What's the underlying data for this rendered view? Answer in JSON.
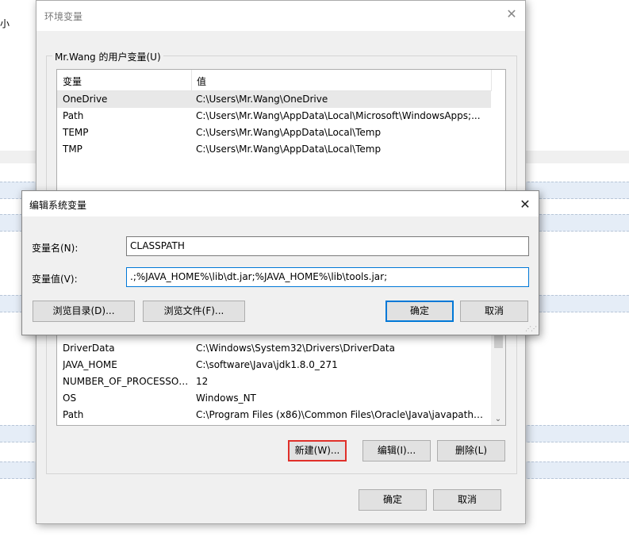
{
  "background": {
    "partial_text": "大小"
  },
  "env_dialog": {
    "title": "环境变量",
    "user_group_label": "Mr.Wang 的用户变量(U)",
    "columns": {
      "name": "变量",
      "value": "值"
    },
    "user_vars": [
      {
        "name": "OneDrive",
        "value": "C:\\Users\\Mr.Wang\\OneDrive"
      },
      {
        "name": "Path",
        "value": "C:\\Users\\Mr.Wang\\AppData\\Local\\Microsoft\\WindowsApps;..."
      },
      {
        "name": "TEMP",
        "value": "C:\\Users\\Mr.Wang\\AppData\\Local\\Temp"
      },
      {
        "name": "TMP",
        "value": "C:\\Users\\Mr.Wang\\AppData\\Local\\Temp"
      }
    ],
    "system_vars": [
      {
        "name": "DriverData",
        "value": "C:\\Windows\\System32\\Drivers\\DriverData"
      },
      {
        "name": "JAVA_HOME",
        "value": "C:\\software\\Java\\jdk1.8.0_271"
      },
      {
        "name": "NUMBER_OF_PROCESSORS",
        "value": "12"
      },
      {
        "name": "OS",
        "value": "Windows_NT"
      },
      {
        "name": "Path",
        "value": "C:\\Program Files (x86)\\Common Files\\Oracle\\Java\\javapath;C:..."
      }
    ],
    "sys_buttons": {
      "new": "新建(W)...",
      "edit": "编辑(I)...",
      "delete": "删除(L)"
    },
    "footer_buttons": {
      "ok": "确定",
      "cancel": "取消"
    }
  },
  "edit_dialog": {
    "title": "编辑系统变量",
    "name_label": "变量名(N):",
    "name_value": "CLASSPATH",
    "value_label": "变量值(V):",
    "value_value": ".;%JAVA_HOME%\\lib\\dt.jar;%JAVA_HOME%\\lib\\tools.jar;",
    "browse_dir": "浏览目录(D)...",
    "browse_file": "浏览文件(F)...",
    "ok": "确定",
    "cancel": "取消"
  },
  "icons": {
    "close": "close-icon",
    "scroll_up": "chevron-up-icon",
    "scroll_down": "chevron-down-icon",
    "grip": "resize-grip-icon"
  }
}
